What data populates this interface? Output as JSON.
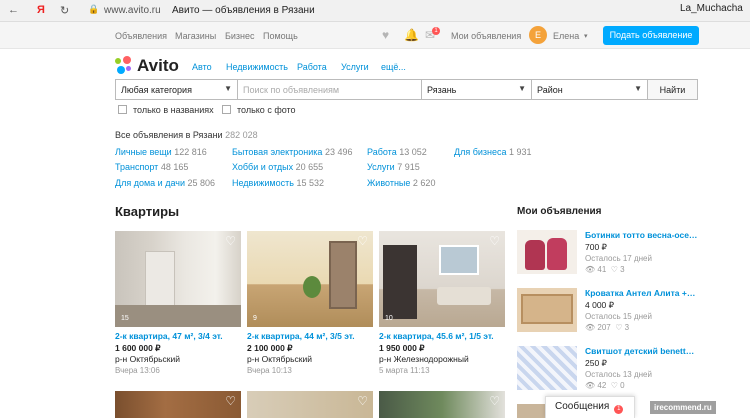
{
  "browser": {
    "url": "www.avito.ru",
    "tab_title": "Авито — объявления в Рязани",
    "user": "La_Muchacha",
    "ya": "Я"
  },
  "topnav": {
    "links": [
      "Объявления",
      "Магазины",
      "Бизнес",
      "Помощь"
    ],
    "my_ads": "Мои объявления",
    "avatar_letter": "Е",
    "user": "Елена",
    "post_button": "Подать объявление",
    "msg_badge": "1"
  },
  "logo": {
    "text": "Avito",
    "dot_colors": [
      "#97cf26",
      "#ff6163",
      "#0af",
      "#a169f7"
    ]
  },
  "catnav": [
    "Авто",
    "Недвижимость",
    "Работа",
    "Услуги",
    "ещё..."
  ],
  "search": {
    "category": "Любая категория",
    "placeholder": "Поиск по объявлениям",
    "city": "Рязань",
    "district": "Район",
    "button": "Найти",
    "only_titles": "только в названиях",
    "only_photo": "только с фото"
  },
  "totals": {
    "label": "Все объявления в Рязани",
    "count": "282 028"
  },
  "categories": [
    {
      "name": "Личные вещи",
      "count": "122 816"
    },
    {
      "name": "Бытовая электроника",
      "count": "23 496"
    },
    {
      "name": "Работа",
      "count": "13 052"
    },
    {
      "name": "Для бизнеса",
      "count": "1 931"
    },
    {
      "name": "Транспорт",
      "count": "48 165"
    },
    {
      "name": "Хобби и отдых",
      "count": "20 655"
    },
    {
      "name": "Услуги",
      "count": "7 915"
    },
    {
      "name": "Для дома и дачи",
      "count": "25 806"
    },
    {
      "name": "Недвижимость",
      "count": "15 532"
    },
    {
      "name": "Животные",
      "count": "2 620"
    }
  ],
  "section_title": "Квартиры",
  "listings": [
    {
      "title": "2-к квартира, 47 м², 3/4 эт.",
      "price": "1 600 000 ₽",
      "location": "р-н Октябрьский",
      "date": "Вчера 13:06",
      "photos": "15"
    },
    {
      "title": "2-к квартира, 44 м², 3/5 эт.",
      "price": "2 100 000 ₽",
      "location": "р-н Октябрьский",
      "date": "Вчера 10:13",
      "photos": "9"
    },
    {
      "title": "2-к квартира, 45.6 м², 1/5 эт.",
      "price": "1 950 000 ₽",
      "location": "р-н Железнодорожный",
      "date": "5 марта 11:13",
      "photos": "10"
    }
  ],
  "my_ads": {
    "title": "Мои объявления",
    "items": [
      {
        "title": "Ботинки тотто весна-осе…",
        "price": "700 ₽",
        "left": "Осталось 17 дней",
        "views": "41",
        "likes": "3"
      },
      {
        "title": "Кроватка Антел Алита +…",
        "price": "4 000 ₽",
        "left": "Осталось 15 дней",
        "views": "207",
        "likes": "3"
      },
      {
        "title": "Свитшот детский benett…",
        "price": "250 ₽",
        "left": "Осталось 13 дней",
        "views": "42",
        "likes": "0"
      }
    ]
  },
  "messages": {
    "label": "Сообщения",
    "badge": "1"
  },
  "watermark": "irecommend.ru"
}
